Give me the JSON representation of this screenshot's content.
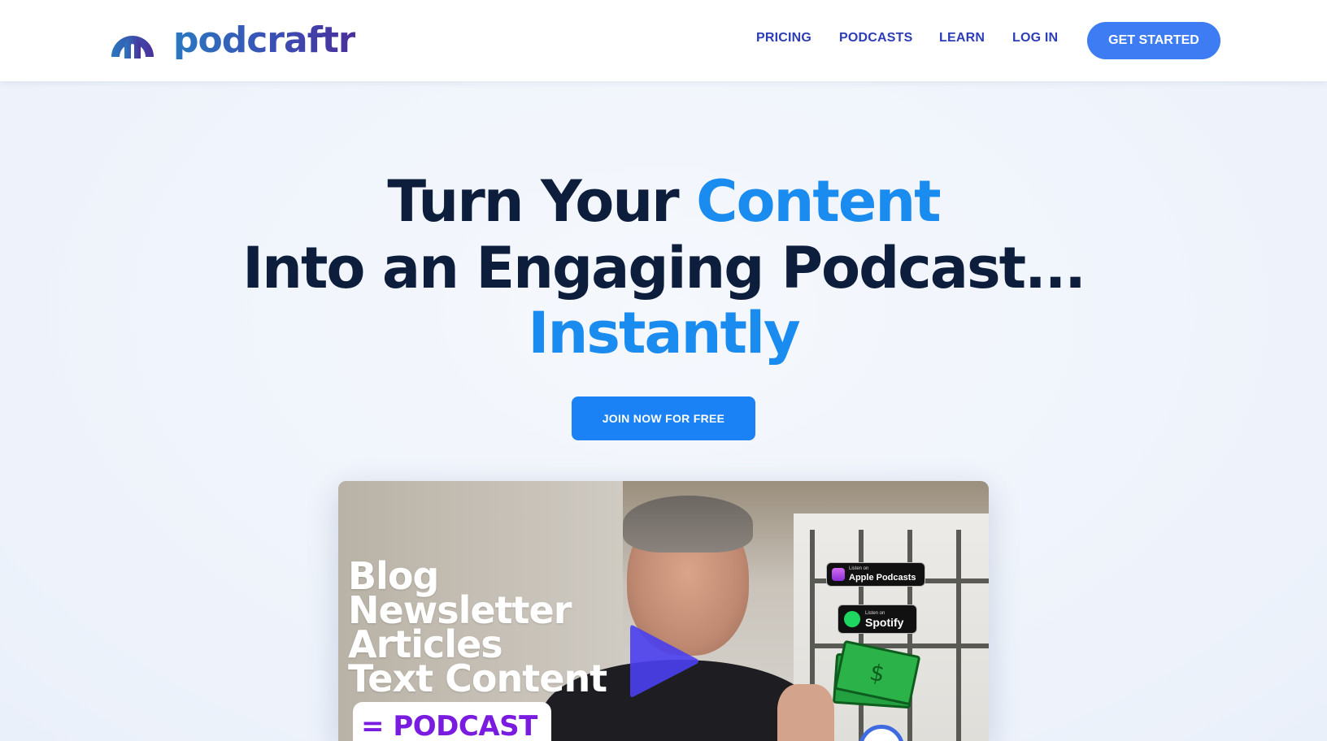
{
  "header": {
    "logo_text": "podcraftr",
    "nav": [
      {
        "label": "PRICING"
      },
      {
        "label": "PODCASTS"
      },
      {
        "label": "LEARN"
      },
      {
        "label": "LOG IN"
      }
    ],
    "cta_label": "GET STARTED"
  },
  "hero": {
    "line1_part1": "Turn Your ",
    "line1_accent": "Content",
    "line2": "Into an Engaging Podcast...",
    "line3_accent": "Instantly",
    "join_label": "JOIN NOW FOR FREE"
  },
  "video": {
    "lines": [
      "Blog",
      "Newsletter",
      "Articles",
      "Text Content"
    ],
    "podcast_label": "= PODCAST",
    "apple_badge": {
      "small": "Listen on",
      "big": "Apple Podcasts"
    },
    "spotify_badge": {
      "small": "Listen on",
      "big": "Spotify"
    },
    "money_symbol": "$"
  },
  "colors": {
    "nav_text": "#2d3db7",
    "cta_bg": "#3d7cf2",
    "headline": "#0d1d3c",
    "accent": "#1a8cf0",
    "join_bg": "#1a82f4",
    "play": "#4a3ff0",
    "podcast_text": "#7a1be0"
  }
}
